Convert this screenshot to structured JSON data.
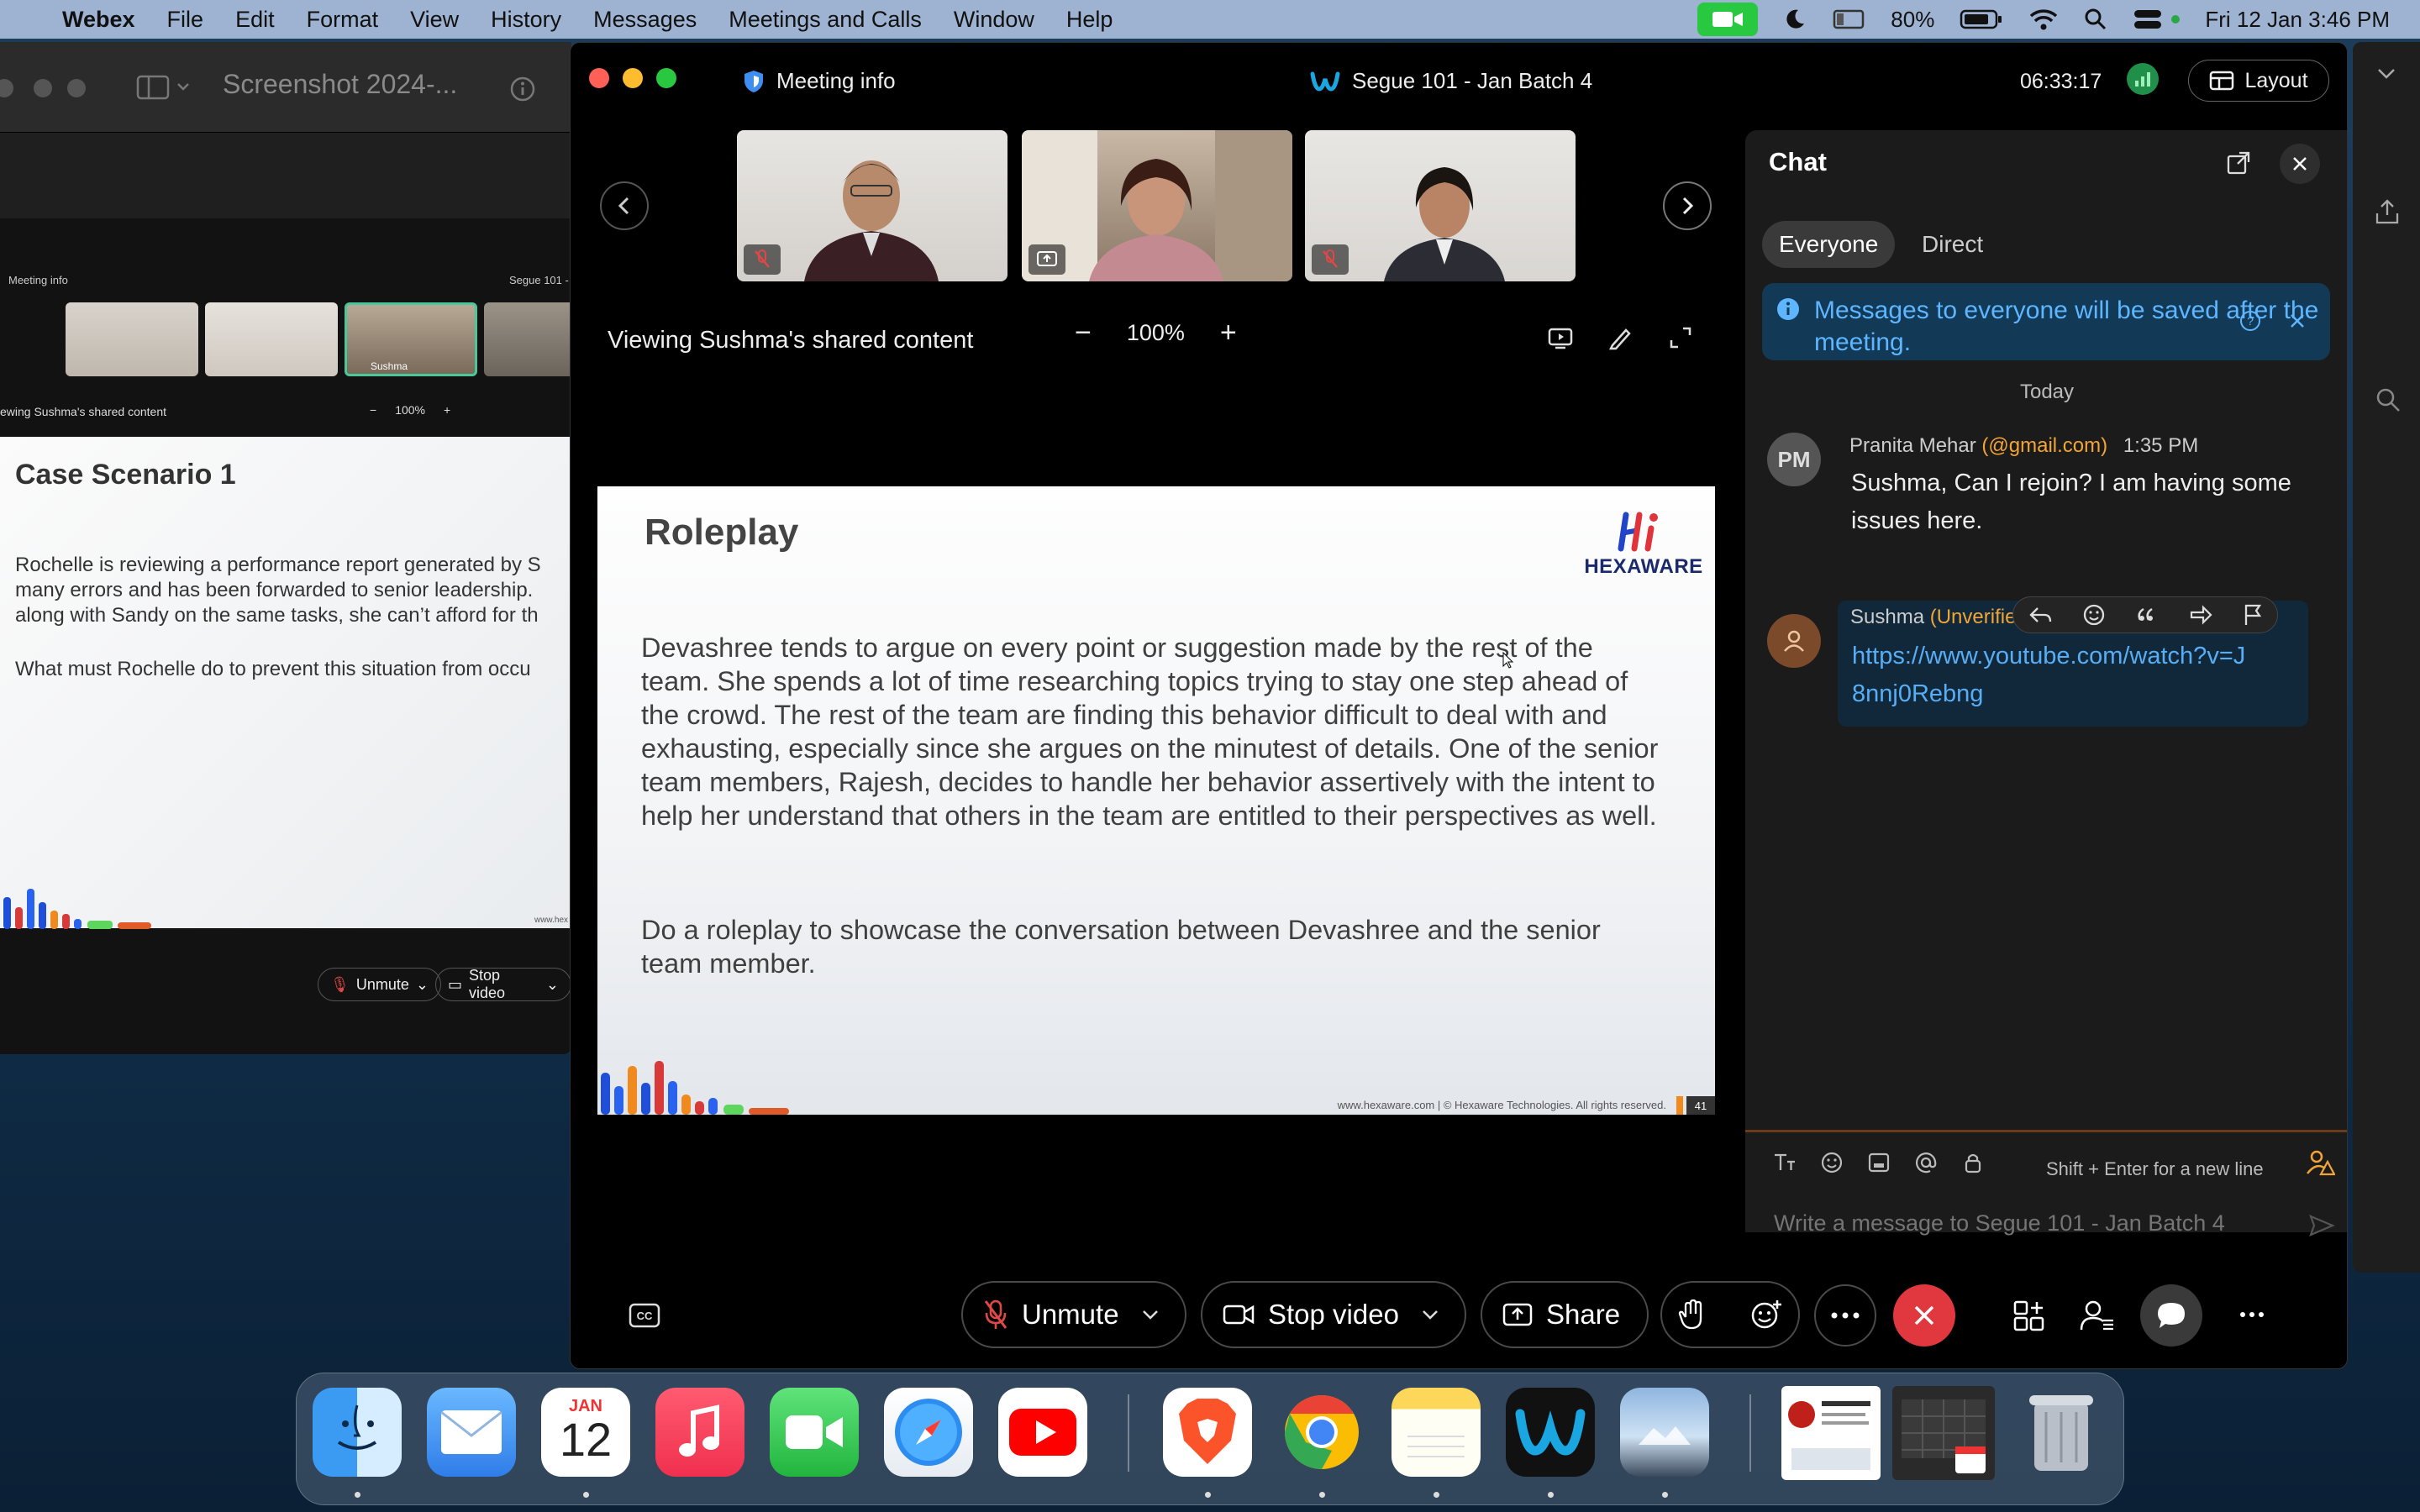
{
  "menubar": {
    "app_name": "Webex",
    "items": [
      "File",
      "Edit",
      "Format",
      "View",
      "History",
      "Messages",
      "Meetings and Calls",
      "Window",
      "Help"
    ],
    "battery": "80%",
    "datetime": "Fri 12 Jan  3:46 PM"
  },
  "bg_window": {
    "title": "Screenshot 2024-...",
    "mini_meeting_info": "Meeting info",
    "mini_title": "Segue 101 -",
    "mini_viewing": "ewing Sushma's shared content",
    "mini_zoom": "100%",
    "mini_name": "Sushma",
    "slide_heading": "Case Scenario 1",
    "slide_lines": [
      "Rochelle is reviewing a performance report generated by S",
      "many errors and has been forwarded to senior leadership.",
      "along with Sandy on the same tasks, she can’t afford for th"
    ],
    "slide_question": "What must Rochelle do to prevent this situation from occu",
    "slide_footer": "www.hex",
    "unmute": "Unmute",
    "stop_video": "Stop video"
  },
  "meeting": {
    "meeting_info": "Meeting info",
    "title": "Segue 101 - Jan Batch 4",
    "timer": "06:33:17",
    "layout_label": "Layout",
    "viewing": "Viewing Sushma's shared content",
    "zoom": "100%"
  },
  "slide": {
    "heading": "Roleplay",
    "logo_word": "HEXAWARE",
    "paragraph": "Devashree tends to argue on every point or suggestion made by the rest of the team. She spends a lot of time researching topics trying to stay one step ahead of the crowd. The rest of the team are finding this behavior difficult to deal with and exhausting, especially since she argues on the minutest of details. One of the senior team members, Rajesh, decides to handle her behavior assertively with the intent to help her understand that others in the team are entitled to their perspectives as well.",
    "task": "Do a roleplay to showcase the conversation between Devashree and the senior team member.",
    "footer": "www.hexaware.com  | © Hexaware Technologies. All rights reserved.",
    "page_number": "41"
  },
  "chat": {
    "title": "Chat",
    "tabs": [
      "Everyone",
      "Direct"
    ],
    "banner": "Messages to everyone will be saved after the meeting.",
    "day": "Today",
    "messages": [
      {
        "initials": "PM",
        "name": "Pranita Mehar",
        "email": "(@gmail.com)",
        "time": "1:35 PM",
        "text": "Sushma, Can I rejoin? I am having some issues here."
      },
      {
        "name": "Sushma",
        "email": "(Unverified,",
        "time": "",
        "text": "https://www.youtube.com/watch?v=J8nnj0Rebng"
      }
    ],
    "hint": "Shift + Enter for a new line",
    "placeholder": "Write a message to Segue 101 - Jan Batch 4"
  },
  "controls": {
    "unmute": "Unmute",
    "stop_video": "Stop video",
    "share": "Share"
  },
  "dock": {
    "calendar_month": "JAN",
    "calendar_day": "12"
  },
  "colors": {
    "end_call": "#e0383e",
    "link": "#58aef5",
    "unverified": "#f2a536",
    "banner_text": "#5db6ff"
  }
}
